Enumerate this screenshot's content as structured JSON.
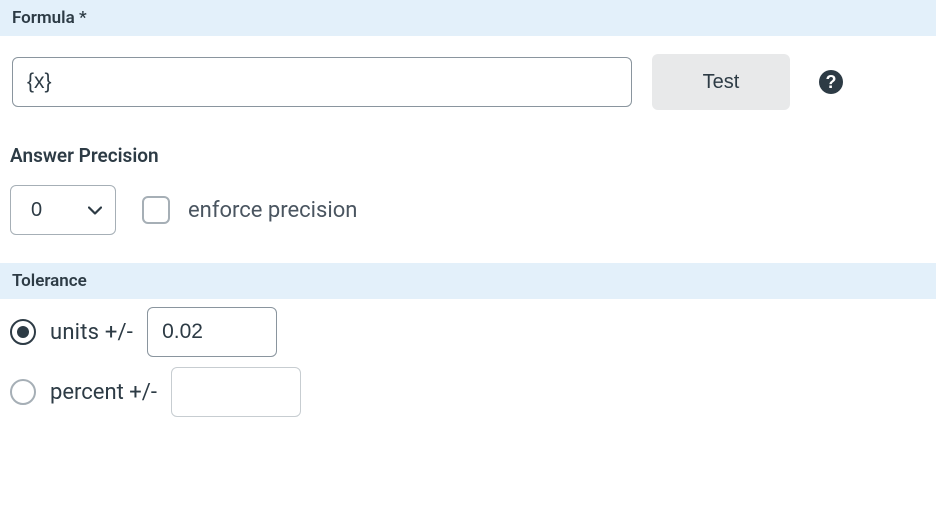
{
  "formula": {
    "header": "Formula *",
    "input_value": "{x}",
    "test_button": "Test"
  },
  "precision": {
    "header": "Answer Precision",
    "value": "0",
    "checkbox_label": "enforce precision",
    "checkbox_checked": false
  },
  "tolerance": {
    "header": "Tolerance",
    "selected": "units",
    "units_label": "units +/-",
    "units_value": "0.02",
    "percent_label": "percent +/-",
    "percent_value": ""
  }
}
